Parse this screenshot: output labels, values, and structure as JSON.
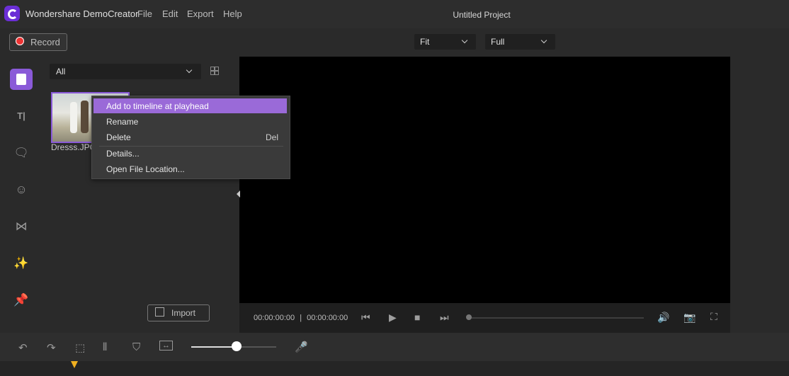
{
  "app": {
    "title": "Wondershare DemoCreator",
    "menu": [
      "File",
      "Edit",
      "Export",
      "Help"
    ],
    "project_title": "Untitled Project"
  },
  "toolbar": {
    "record_label": "Record",
    "fit_value": "Fit",
    "quality_value": "Full"
  },
  "media": {
    "filter_value": "All",
    "items": [
      {
        "name": "Dresss.JPG"
      }
    ],
    "import_label": "Import"
  },
  "context_menu": {
    "items": [
      {
        "label": "Add to timeline at playhead",
        "shortcut": ""
      },
      {
        "label": "Rename",
        "shortcut": ""
      },
      {
        "label": "Delete",
        "shortcut": "Del"
      },
      {
        "label": "Details...",
        "shortcut": ""
      },
      {
        "label": "Open File Location...",
        "shortcut": ""
      }
    ]
  },
  "player": {
    "current_time": "00:00:00:00",
    "separator": "|",
    "total_time": "00:00:00:00"
  },
  "colors": {
    "accent": "#9a6ad8",
    "record": "#e33333",
    "playhead": "#f0b020"
  },
  "zoom": {
    "level_fraction": 0.53
  }
}
